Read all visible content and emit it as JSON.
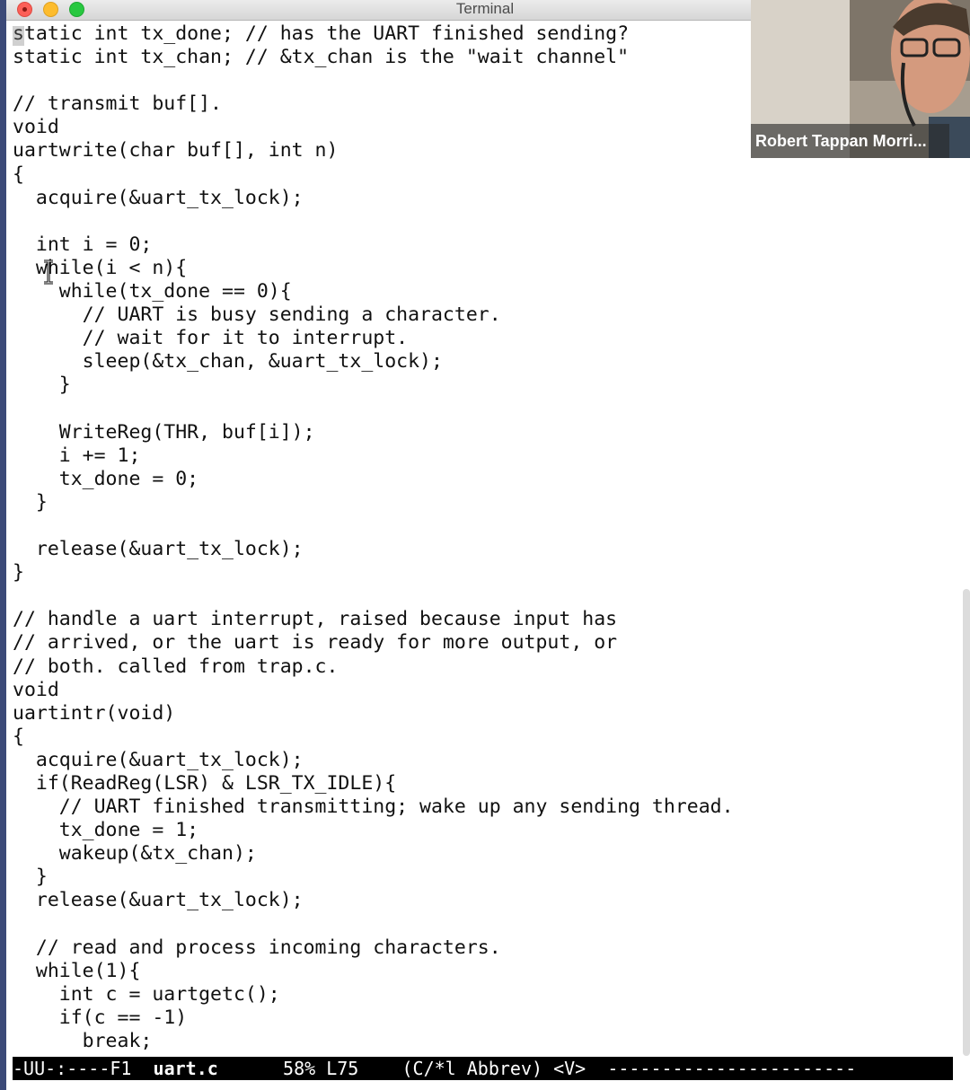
{
  "window": {
    "title": "Terminal"
  },
  "editor": {
    "lines": [
      "static int tx_done; // has the UART finished sending?",
      "static int tx_chan; // &tx_chan is the \"wait channel\"",
      "",
      "// transmit buf[].",
      "void",
      "uartwrite(char buf[], int n)",
      "{",
      "  acquire(&uart_tx_lock);",
      "",
      "  int i = 0;",
      "  while(i < n){",
      "    while(tx_done == 0){",
      "      // UART is busy sending a character.",
      "      // wait for it to interrupt.",
      "      sleep(&tx_chan, &uart_tx_lock);",
      "    }",
      "",
      "    WriteReg(THR, buf[i]);",
      "    i += 1;",
      "    tx_done = 0;",
      "  }",
      "",
      "  release(&uart_tx_lock);",
      "}",
      "",
      "// handle a uart interrupt, raised because input has",
      "// arrived, or the uart is ready for more output, or",
      "// both. called from trap.c.",
      "void",
      "uartintr(void)",
      "{",
      "  acquire(&uart_tx_lock);",
      "  if(ReadReg(LSR) & LSR_TX_IDLE){",
      "    // UART finished transmitting; wake up any sending thread.",
      "    tx_done = 1;",
      "    wakeup(&tx_chan);",
      "  }",
      "  release(&uart_tx_lock);",
      "",
      "  // read and process incoming characters.",
      "  while(1){",
      "    int c = uartgetc();",
      "    if(c == -1)",
      "      break;"
    ]
  },
  "modeline": {
    "status": "-UU-:----F1  ",
    "buffer": "uart.c",
    "position": "58% L75",
    "mode": "(C/*l Abbrev) <V>",
    "fill": "-----------------------"
  },
  "video": {
    "participant_name": "Robert Tappan Morri..."
  },
  "colors": {
    "modeline_bg": "#000000",
    "modeline_fg": "#ffffff",
    "editor_bg": "#ffffff",
    "close_light": "#fc5f57",
    "minimize_light": "#fdbc2e",
    "maximize_light": "#28c840"
  }
}
